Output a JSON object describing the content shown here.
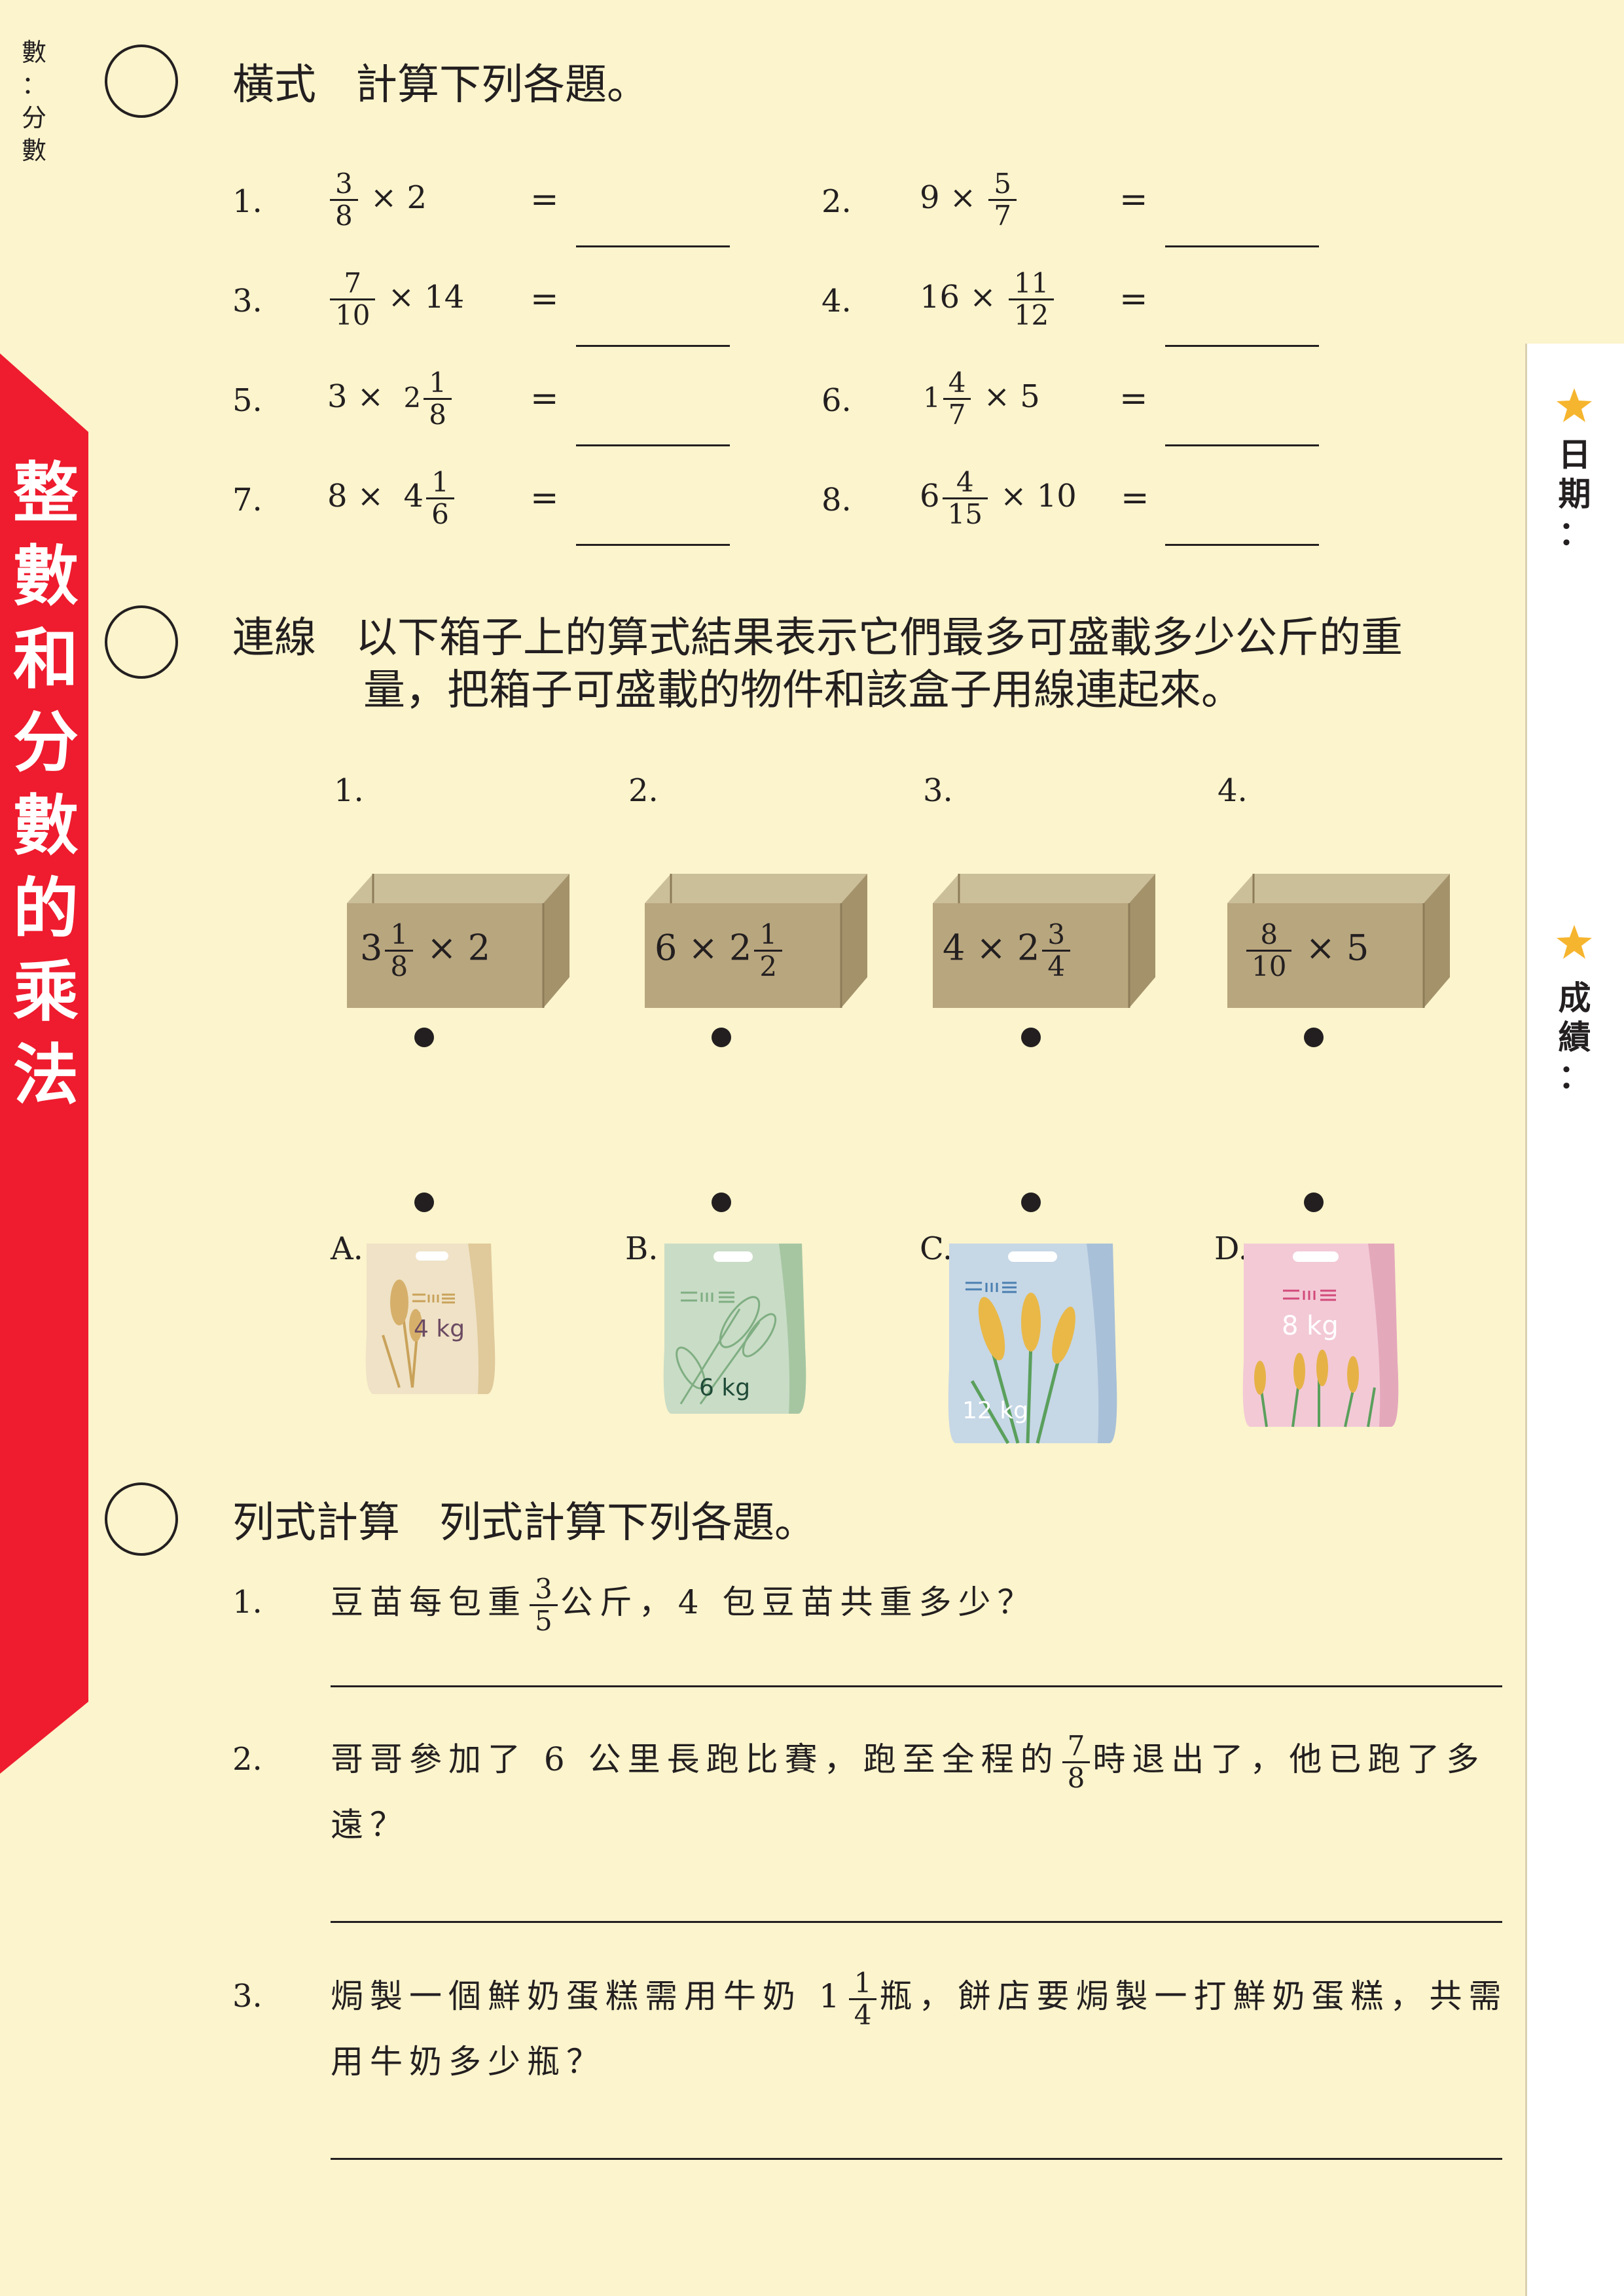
{
  "corner_labels": [
    "數",
    "：",
    "分",
    "數"
  ],
  "banner_title": [
    "整",
    "數",
    "和",
    "分",
    "數",
    "的",
    "乘",
    "法"
  ],
  "side": {
    "date_label": [
      "日",
      "期",
      "："
    ],
    "score_label": [
      "成",
      "績",
      "："
    ]
  },
  "section1": {
    "type": "橫式",
    "instruction": "計算下列各題。",
    "items": [
      {
        "no": "1.",
        "a": "",
        "fa": [
          "",
          "3",
          "8"
        ],
        "op": "×",
        "b": "2"
      },
      {
        "no": "2.",
        "a": "9",
        "op": "×",
        "fb": [
          "",
          "5",
          "7"
        ]
      },
      {
        "no": "3.",
        "fa": [
          "",
          "7",
          "10"
        ],
        "op": "×",
        "b": "14"
      },
      {
        "no": "4.",
        "a": "16",
        "op": "×",
        "fb": [
          "",
          "11",
          "12"
        ]
      },
      {
        "no": "5.",
        "a": "3",
        "op": "×",
        "fb": [
          "2",
          "1",
          "8"
        ]
      },
      {
        "no": "6.",
        "fa": [
          "1",
          "4",
          "7"
        ],
        "op": "×",
        "b": "5"
      },
      {
        "no": "7.",
        "a": "8",
        "op": "×",
        "fb": [
          "4",
          "1",
          "6"
        ]
      },
      {
        "no": "8.",
        "fa": [
          "6",
          "4",
          "15"
        ],
        "op": "×",
        "b": "10"
      }
    ],
    "equals": "="
  },
  "section2": {
    "type": "連線",
    "instruction_line1": "以下箱子上的算式結果表示它們最多可盛載多少公斤的重",
    "instruction_line2": "量，把箱子可盛載的物件和該盒子用線連起來。",
    "boxes": [
      {
        "no": "1.",
        "whole": "3",
        "num": "1",
        "den": "8",
        "op": "×",
        "b": "2"
      },
      {
        "no": "2.",
        "a": "6",
        "op": "×",
        "whole": "2",
        "num": "1",
        "den": "2"
      },
      {
        "no": "3.",
        "a": "4",
        "op": "×",
        "whole": "2",
        "num": "3",
        "den": "4"
      },
      {
        "no": "4.",
        "num": "8",
        "den": "10",
        "op": "×",
        "b": "5"
      }
    ],
    "bags": [
      {
        "letter": "A.",
        "weight": "4 kg",
        "color": "#efe2c6",
        "accent": "#c9a25a"
      },
      {
        "letter": "B.",
        "weight": "6 kg",
        "color": "#c9dcc6",
        "accent": "#7fae82"
      },
      {
        "letter": "C.",
        "weight": "12 kg",
        "color": "#c6d7e6",
        "accent": "#e9b847"
      },
      {
        "letter": "D.",
        "weight": "8 kg",
        "color": "#f3c9d6",
        "accent": "#e6b246"
      }
    ]
  },
  "section3": {
    "type": "列式計算",
    "instruction": "列式計算下列各題。",
    "q1": {
      "no": "1.",
      "pre": "豆苗每包重",
      "num": "3",
      "den": "5",
      "post": "公斤，4 包豆苗共重多少？"
    },
    "q2": {
      "no": "2.",
      "pre": "哥哥參加了 6 公里長跑比賽，跑至全程的",
      "num": "7",
      "den": "8",
      "post": "時退出了，他已跑了多",
      "line2": "遠？"
    },
    "q3": {
      "no": "3.",
      "pre": "焗製一個鮮奶蛋糕需用牛奶 1",
      "num": "1",
      "den": "4",
      "post": "瓶，餅店要焗製一打鮮奶蛋糕，共需",
      "line2": "用牛奶多少瓶？"
    }
  },
  "colors": {
    "page": "#fbf4cc",
    "banner": "#ee1c2e",
    "box": "#b8a67e",
    "box_dark": "#a4926b"
  }
}
